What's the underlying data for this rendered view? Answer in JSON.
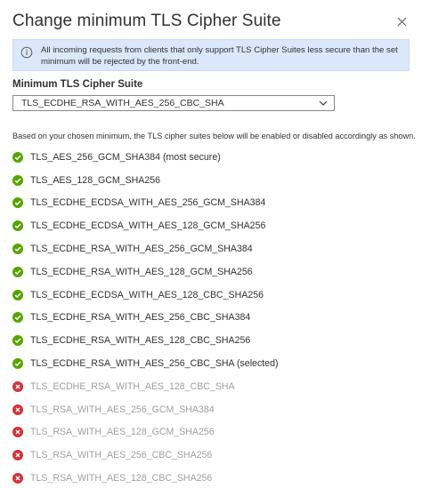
{
  "dialog": {
    "title": "Change minimum TLS Cipher Suite",
    "close_icon": "close-icon"
  },
  "info_bar": {
    "icon": "info-icon",
    "text": "All incoming requests from clients that only support TLS Cipher Suites less secure than the set minimum will be rejected by the front-end."
  },
  "field": {
    "label": "Minimum TLS Cipher Suite",
    "selected_value": "TLS_ECDHE_RSA_WITH_AES_256_CBC_SHA",
    "dropdown_icon": "chevron-down-icon"
  },
  "description": "Based on your chosen minimum, the TLS cipher suites below will be enabled or disabled accordingly as shown.",
  "colors": {
    "enabled": "#57a300",
    "disabled": "#d13438",
    "info_background": "#dbe8fb"
  },
  "suites": [
    {
      "label": "TLS_AES_256_GCM_SHA384 (most secure)",
      "status": "enabled"
    },
    {
      "label": "TLS_AES_128_GCM_SHA256",
      "status": "enabled"
    },
    {
      "label": "TLS_ECDHE_ECDSA_WITH_AES_256_GCM_SHA384",
      "status": "enabled"
    },
    {
      "label": "TLS_ECDHE_ECDSA_WITH_AES_128_GCM_SHA256",
      "status": "enabled"
    },
    {
      "label": "TLS_ECDHE_RSA_WITH_AES_256_GCM_SHA384",
      "status": "enabled"
    },
    {
      "label": "TLS_ECDHE_RSA_WITH_AES_128_GCM_SHA256",
      "status": "enabled"
    },
    {
      "label": "TLS_ECDHE_ECDSA_WITH_AES_128_CBC_SHA256",
      "status": "enabled"
    },
    {
      "label": "TLS_ECDHE_RSA_WITH_AES_256_CBC_SHA384",
      "status": "enabled"
    },
    {
      "label": "TLS_ECDHE_RSA_WITH_AES_128_CBC_SHA256",
      "status": "enabled"
    },
    {
      "label": "TLS_ECDHE_RSA_WITH_AES_256_CBC_SHA (selected)",
      "status": "enabled"
    },
    {
      "label": "TLS_ECDHE_RSA_WITH_AES_128_CBC_SHA",
      "status": "disabled"
    },
    {
      "label": "TLS_RSA_WITH_AES_256_GCM_SHA384",
      "status": "disabled"
    },
    {
      "label": "TLS_RSA_WITH_AES_128_GCM_SHA256",
      "status": "disabled"
    },
    {
      "label": "TLS_RSA_WITH_AES_256_CBC_SHA256",
      "status": "disabled"
    },
    {
      "label": "TLS_RSA_WITH_AES_128_CBC_SHA256",
      "status": "disabled"
    }
  ]
}
